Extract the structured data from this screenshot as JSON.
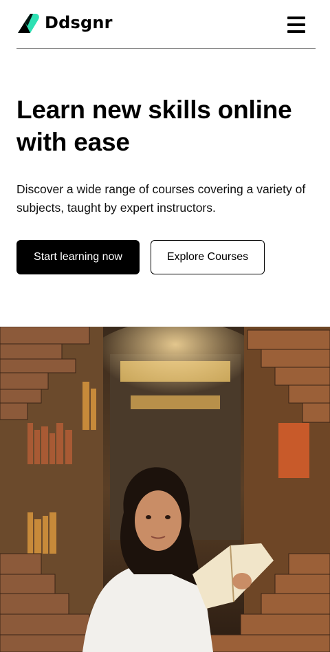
{
  "brand": {
    "name": "Ddsgnr",
    "logo_color": "#2ee0b3"
  },
  "header": {
    "menu_icon": "hamburger-menu-icon"
  },
  "hero": {
    "title": "Learn new skills online with ease",
    "subtitle": "Discover a wide range of courses covering a variety of subjects, taught by expert instructors.",
    "primary_button": "Start learning now",
    "secondary_button": "Explore Courses"
  },
  "image": {
    "subject": "woman reading a book in a bookstore"
  }
}
